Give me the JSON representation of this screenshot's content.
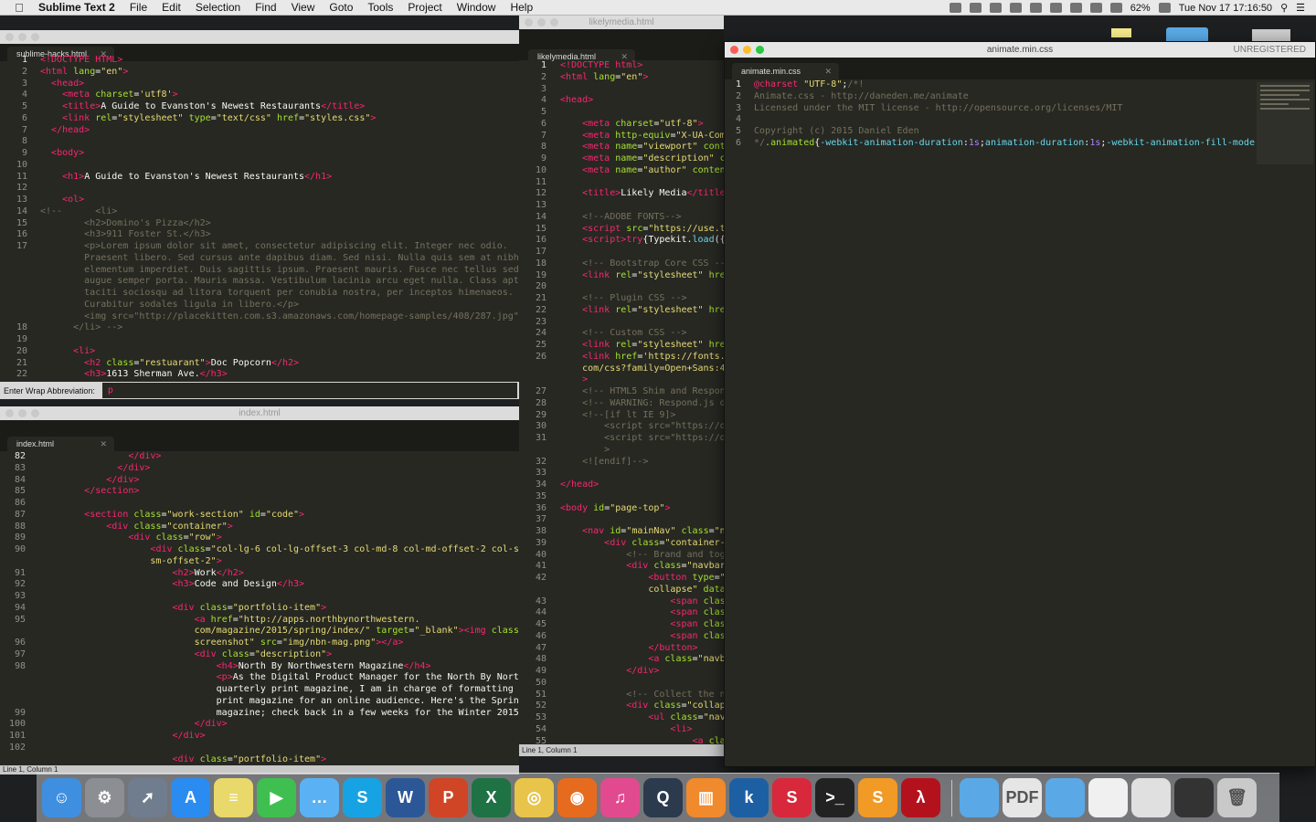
{
  "menubar": {
    "app_name": "Sublime Text 2",
    "items": [
      "File",
      "Edit",
      "Selection",
      "Find",
      "View",
      "Goto",
      "Tools",
      "Project",
      "Window",
      "Help"
    ],
    "battery": "62%",
    "datetime": "Tue Nov 17  17:16:50"
  },
  "windows": {
    "hacks": {
      "title": "sublime-hacks.html",
      "tab": "sublime-hacks.html",
      "lines": [
        "1",
        "2",
        "3",
        "4",
        "5",
        "6",
        "7",
        "8",
        "9",
        "10",
        "11",
        "12",
        "13",
        "14",
        "15",
        "16",
        "17",
        "",
        "",
        "",
        "",
        "",
        "",
        "18",
        "19",
        "20",
        "21",
        "22",
        "23"
      ]
    },
    "abbrev": {
      "label": "Enter Wrap Abbreviation:",
      "value": "p"
    },
    "index": {
      "title": "index.html",
      "tab": "index.html",
      "lines": [
        "82",
        "83",
        "84",
        "85",
        "86",
        "87",
        "88",
        "89",
        "90",
        "",
        "91",
        "92",
        "93",
        "94",
        "95",
        "",
        "96",
        "97",
        "98",
        "",
        "",
        "",
        "99",
        "100",
        "101",
        "102"
      ],
      "status": "Line 1, Column 1"
    },
    "likely": {
      "title": "likelymedia.html",
      "tab": "likelymedia.html",
      "lines": [
        "1",
        "2",
        "3",
        "4",
        "5",
        "6",
        "7",
        "8",
        "9",
        "10",
        "11",
        "12",
        "13",
        "14",
        "15",
        "16",
        "17",
        "18",
        "19",
        "20",
        "21",
        "22",
        "23",
        "24",
        "25",
        "26",
        "",
        "",
        "27",
        "28",
        "29",
        "30",
        "31",
        "",
        "32",
        "33",
        "34",
        "35",
        "36",
        "37",
        "38",
        "39",
        "40",
        "41",
        "42",
        "",
        "43",
        "44",
        "45",
        "46",
        "47",
        "48",
        "49",
        "50",
        "51",
        "52",
        "53",
        "54",
        "55"
      ],
      "status": "Line 1, Column 1",
      "unregistered": "UNREGISTERED"
    },
    "animate": {
      "title": "animate.min.css",
      "tab": "animate.min.css",
      "unregistered": "UNREGISTERED",
      "lines": [
        "1",
        "2",
        "3",
        "4",
        "5",
        "6"
      ]
    }
  },
  "dock": {
    "apps": [
      {
        "name": "Finder",
        "color": "#3f8fe0",
        "glyph": "☺"
      },
      {
        "name": "System Preferences",
        "color": "#8b8e92",
        "glyph": "⚙"
      },
      {
        "name": "Launchpad",
        "color": "#6f7d8f",
        "glyph": "➚"
      },
      {
        "name": "App Store",
        "color": "#2a8cf0",
        "glyph": "A"
      },
      {
        "name": "Stickies",
        "color": "#e9d86a",
        "glyph": "≡"
      },
      {
        "name": "FaceTime",
        "color": "#3fbf4f",
        "glyph": "▶"
      },
      {
        "name": "Messages",
        "color": "#5ab2f5",
        "glyph": "…"
      },
      {
        "name": "Skype",
        "color": "#17a3e3",
        "glyph": "S"
      },
      {
        "name": "Word",
        "color": "#2b5797",
        "glyph": "W"
      },
      {
        "name": "PowerPoint",
        "color": "#d04525",
        "glyph": "P"
      },
      {
        "name": "Excel",
        "color": "#1f7244",
        "glyph": "X"
      },
      {
        "name": "Chrome",
        "color": "#e8c54a",
        "glyph": "◎"
      },
      {
        "name": "Firefox",
        "color": "#e66b1f",
        "glyph": "◉"
      },
      {
        "name": "iTunes",
        "color": "#e24a8f",
        "glyph": "♫"
      },
      {
        "name": "QuickTime",
        "color": "#2b3a4d",
        "glyph": "Q"
      },
      {
        "name": "iBooks",
        "color": "#f08a2c",
        "glyph": "▥"
      },
      {
        "name": "Kindle",
        "color": "#1d5fa3",
        "glyph": "k"
      },
      {
        "name": "Skitch",
        "color": "#d7283c",
        "glyph": "S"
      },
      {
        "name": "Terminal",
        "color": "#222222",
        "glyph": ">_"
      },
      {
        "name": "Sublime Text",
        "color": "#f29a26",
        "glyph": "S"
      },
      {
        "name": "Acrobat",
        "color": "#b3121d",
        "glyph": "λ"
      }
    ],
    "docs": [
      {
        "name": "Folder",
        "color": "#5aa9e6",
        "glyph": ""
      },
      {
        "name": "PDF",
        "color": "#e6e6e6",
        "glyph": "PDF"
      },
      {
        "name": "Folder 2",
        "color": "#5aa9e6",
        "glyph": ""
      },
      {
        "name": "Document",
        "color": "#f0f0f0",
        "glyph": ""
      },
      {
        "name": "Document 2",
        "color": "#e0e0e0",
        "glyph": ""
      },
      {
        "name": "Screenshot",
        "color": "#333333",
        "glyph": ""
      },
      {
        "name": "Trash",
        "color": "#c9c9c9",
        "glyph": "🗑"
      }
    ]
  }
}
